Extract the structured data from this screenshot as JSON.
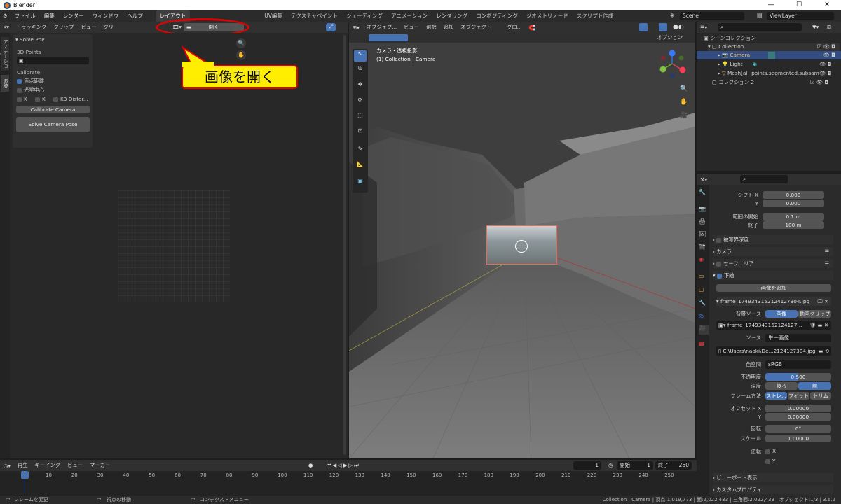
{
  "titlebar": {
    "title": "Blender",
    "min": "—",
    "max": "☐",
    "close": "✕"
  },
  "menu": [
    "ファイル",
    "編集",
    "レンダー",
    "ウィンドウ",
    "ヘルプ"
  ],
  "workspaces": [
    "レイアウト",
    "UV編集",
    "テクスチャペイント",
    "シェーディング",
    "アニメーション",
    "レンダリング",
    "コンポジティング",
    "ジオメトリノード",
    "スクリプト作成"
  ],
  "scene": {
    "scene_name": "Scene",
    "view_layer": "ViewLayer"
  },
  "clip_editor": {
    "header": {
      "mode": "トラッキング",
      "clip": "クリップ",
      "view": "ビュー",
      "clip2": "クリ",
      "open_label": "開く"
    },
    "callout": "画像を開く",
    "sidebar_tabs": [
      "アノテーション",
      "追跡"
    ],
    "panel": {
      "title": "Solve PnP",
      "points_label": "3D Points",
      "calibrate_label": "Calibrate",
      "focal": "焦点距離",
      "optical_center": "光学中心",
      "k1": "K",
      "k2": "K",
      "k3": "K3 Distor...",
      "calibrate_btn": "Calibrate Camera",
      "solve_btn": "Solve Camera Pose"
    }
  },
  "viewport": {
    "header": {
      "mode": "オブジェク...",
      "view": "ビュー",
      "select": "選択",
      "add": "追加",
      "object": "オブジェクト",
      "transform": "グロ...",
      "options": "オプション"
    },
    "overlay_line1": "カメラ・透視投影",
    "overlay_line2": "(1) Collection | Camera"
  },
  "outliner": {
    "root": "シーンコレクション",
    "items": [
      {
        "label": "Collection",
        "type": "collection"
      },
      {
        "label": "Camera",
        "type": "camera"
      },
      {
        "label": "Light",
        "type": "light"
      },
      {
        "label": "Mesh[all_points.segmented.subsam",
        "type": "mesh"
      },
      {
        "label": "コレクション 2",
        "type": "collection"
      }
    ]
  },
  "properties": {
    "shift_x_label": "シフト X",
    "shift_x": "0.000",
    "shift_y_label": "Y",
    "shift_y": "0.000",
    "clip_start_label": "範囲の開始",
    "clip_start": "0.1 m",
    "clip_end_label": "終了",
    "clip_end": "100 m",
    "dof": "被写界深度",
    "camera": "カメラ",
    "safe": "セーフエリア",
    "bg": "下絵",
    "add_image": "画像を追加",
    "frame_name": "frame_1749343152124127304.jpg",
    "bg_source_label": "背景ソース",
    "bg_source_image": "画像",
    "bg_source_clip": "動画クリップ",
    "image_name": "frame_1749343152124127...",
    "source_label": "ソース",
    "source_value": "単一画像",
    "filepath": "C:\\Users\\naoki\\De...2124127304.jpg",
    "colorspace_label": "色空間",
    "colorspace": "sRGB",
    "opacity_label": "不透明度",
    "opacity": "0.500",
    "depth_label": "深度",
    "depth_back": "後ろ",
    "depth_front": "前",
    "frame_method_label": "フレーム方法",
    "fm_stretch": "ストレ...",
    "fm_fit": "フィット",
    "fm_crop": "トリム",
    "offset_x_label": "オフセット X",
    "offset_x": "0.00000",
    "offset_y_label": "Y",
    "offset_y": "0.00000",
    "rotation_label": "回転",
    "rotation": "0°",
    "scale_label": "スケール",
    "scale": "1.00000",
    "flip_label": "逆転",
    "flip_x": "X",
    "flip_y": "Y",
    "viewport_display": "ビューポート表示",
    "custom_props": "カスタムプロパティ"
  },
  "timeline": {
    "play": "再生",
    "keying": "キーイング",
    "view": "ビュー",
    "marker": "マーカー",
    "current_frame": "1",
    "start_label": "開始",
    "start": "1",
    "end_label": "終了",
    "end": "250",
    "ticks": [
      "1",
      "10",
      "20",
      "30",
      "40",
      "50",
      "60",
      "70",
      "80",
      "90",
      "100",
      "110",
      "120",
      "130",
      "140",
      "150",
      "160",
      "170",
      "180",
      "190",
      "200",
      "210",
      "220",
      "230",
      "240",
      "250"
    ]
  },
  "statusbar": {
    "change_frame": "フレームを変更",
    "move_view": "視点の移動",
    "context_menu": "コンテクストメニュー",
    "stats": "Collection | Camera | 頂点:1,019,773 | 面:2,022,433 | 三角面:2,022,433 | オブジェクト:1/3 | 3.6.2"
  },
  "colors": {
    "accent": "#4772b3",
    "callout_fill": "#ffee00",
    "callout_border": "#e10000",
    "camera_bg": "#3b5f8f"
  }
}
